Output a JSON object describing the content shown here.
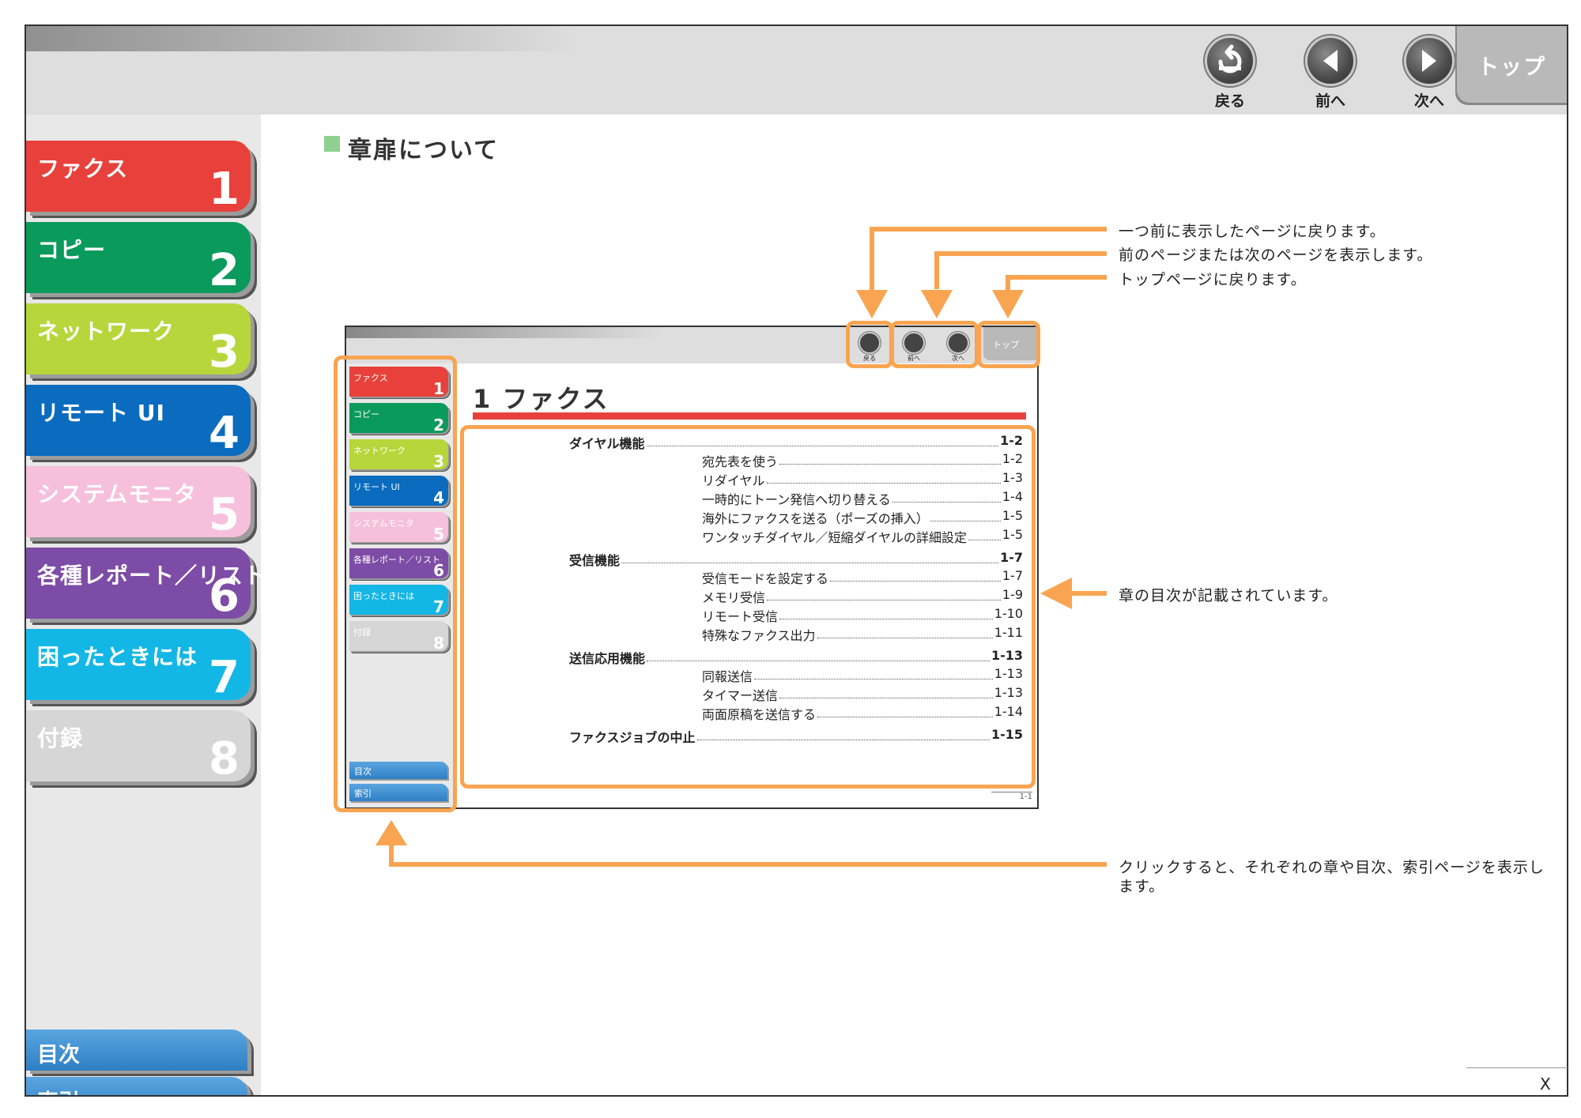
{
  "nav": {
    "back_label": "戻る",
    "prev_label": "前へ",
    "next_label": "次へ",
    "top_label": "トップ"
  },
  "sidebar": {
    "tabs": [
      {
        "label": "ファクス",
        "num": "1",
        "color": "#e8413b"
      },
      {
        "label": "コピー",
        "num": "2",
        "color": "#0a9a5c"
      },
      {
        "label": "ネットワーク",
        "num": "3",
        "color": "#b7d63b"
      },
      {
        "label": "リモート UI",
        "num": "4",
        "color": "#0a6bbf"
      },
      {
        "label": "システムモニタ",
        "num": "5",
        "color": "#f6c0dc"
      },
      {
        "label": "各種レポート／リスト",
        "num": "6",
        "color": "#7d4ca6"
      },
      {
        "label": "困ったときには",
        "num": "7",
        "color": "#13b7e6"
      },
      {
        "label": "付録",
        "num": "8",
        "color": "#d6d6d6"
      }
    ],
    "contents_label": "目次",
    "index_label": "索引"
  },
  "section_title": "章扉について",
  "annotations": {
    "back_desc": "一つ前に表示したページに戻ります。",
    "prevnext_desc": "前のページまたは次のページを表示します。",
    "top_desc": "トップページに戻ります。",
    "toc_desc": "章の目次が記載されています。",
    "tabs_desc_1": "クリックすると、それぞれの章や目次、索引ページを表示し",
    "tabs_desc_2": "ます。"
  },
  "mini": {
    "nav_back": "戻る",
    "nav_prev": "前へ",
    "nav_next": "次へ",
    "nav_top": "トップ",
    "tabs": [
      {
        "label": "ファクス",
        "num": "1",
        "color": "#e8413b"
      },
      {
        "label": "コピー",
        "num": "2",
        "color": "#0a9a5c"
      },
      {
        "label": "ネットワーク",
        "num": "3",
        "color": "#b7d63b"
      },
      {
        "label": "リモート UI",
        "num": "4",
        "color": "#0a6bbf"
      },
      {
        "label": "システムモニタ",
        "num": "5",
        "color": "#f6c0dc"
      },
      {
        "label": "各種レポート／リスト",
        "num": "6",
        "color": "#7d4ca6"
      },
      {
        "label": "困ったときには",
        "num": "7",
        "color": "#13b7e6"
      },
      {
        "label": "付録",
        "num": "8",
        "color": "#d6d6d6"
      }
    ],
    "contents_label": "目次",
    "index_label": "索引",
    "chapter_title": "1 ファクス",
    "page_number": "1-1",
    "toc": [
      {
        "text": "ダイヤル機能",
        "page": "1-2",
        "bold": true
      },
      {
        "text": "宛先表を使う",
        "page": "1-2",
        "bold": false
      },
      {
        "text": "リダイヤル",
        "page": "1-3",
        "bold": false
      },
      {
        "text": "一時的にトーン発信へ切り替える",
        "page": "1-4",
        "bold": false
      },
      {
        "text": "海外にファクスを送る（ポーズの挿入）",
        "page": "1-5",
        "bold": false
      },
      {
        "text": "ワンタッチダイヤル／短縮ダイヤルの詳細設定",
        "page": "1-5",
        "bold": false
      },
      {
        "text": "受信機能",
        "page": "1-7",
        "bold": true
      },
      {
        "text": "受信モードを設定する",
        "page": "1-7",
        "bold": false
      },
      {
        "text": "メモリ受信",
        "page": "1-9",
        "bold": false
      },
      {
        "text": "リモート受信",
        "page": "1-10",
        "bold": false
      },
      {
        "text": "特殊なファクス出力",
        "page": "1-11",
        "bold": false
      },
      {
        "text": "送信応用機能",
        "page": "1-13",
        "bold": true
      },
      {
        "text": "同報送信",
        "page": "1-13",
        "bold": false
      },
      {
        "text": "タイマー送信",
        "page": "1-13",
        "bold": false
      },
      {
        "text": "両面原稿を送信する",
        "page": "1-14",
        "bold": false
      },
      {
        "text": "ファクスジョブの中止",
        "page": "1-15",
        "bold": true
      }
    ]
  },
  "close_label": "X"
}
